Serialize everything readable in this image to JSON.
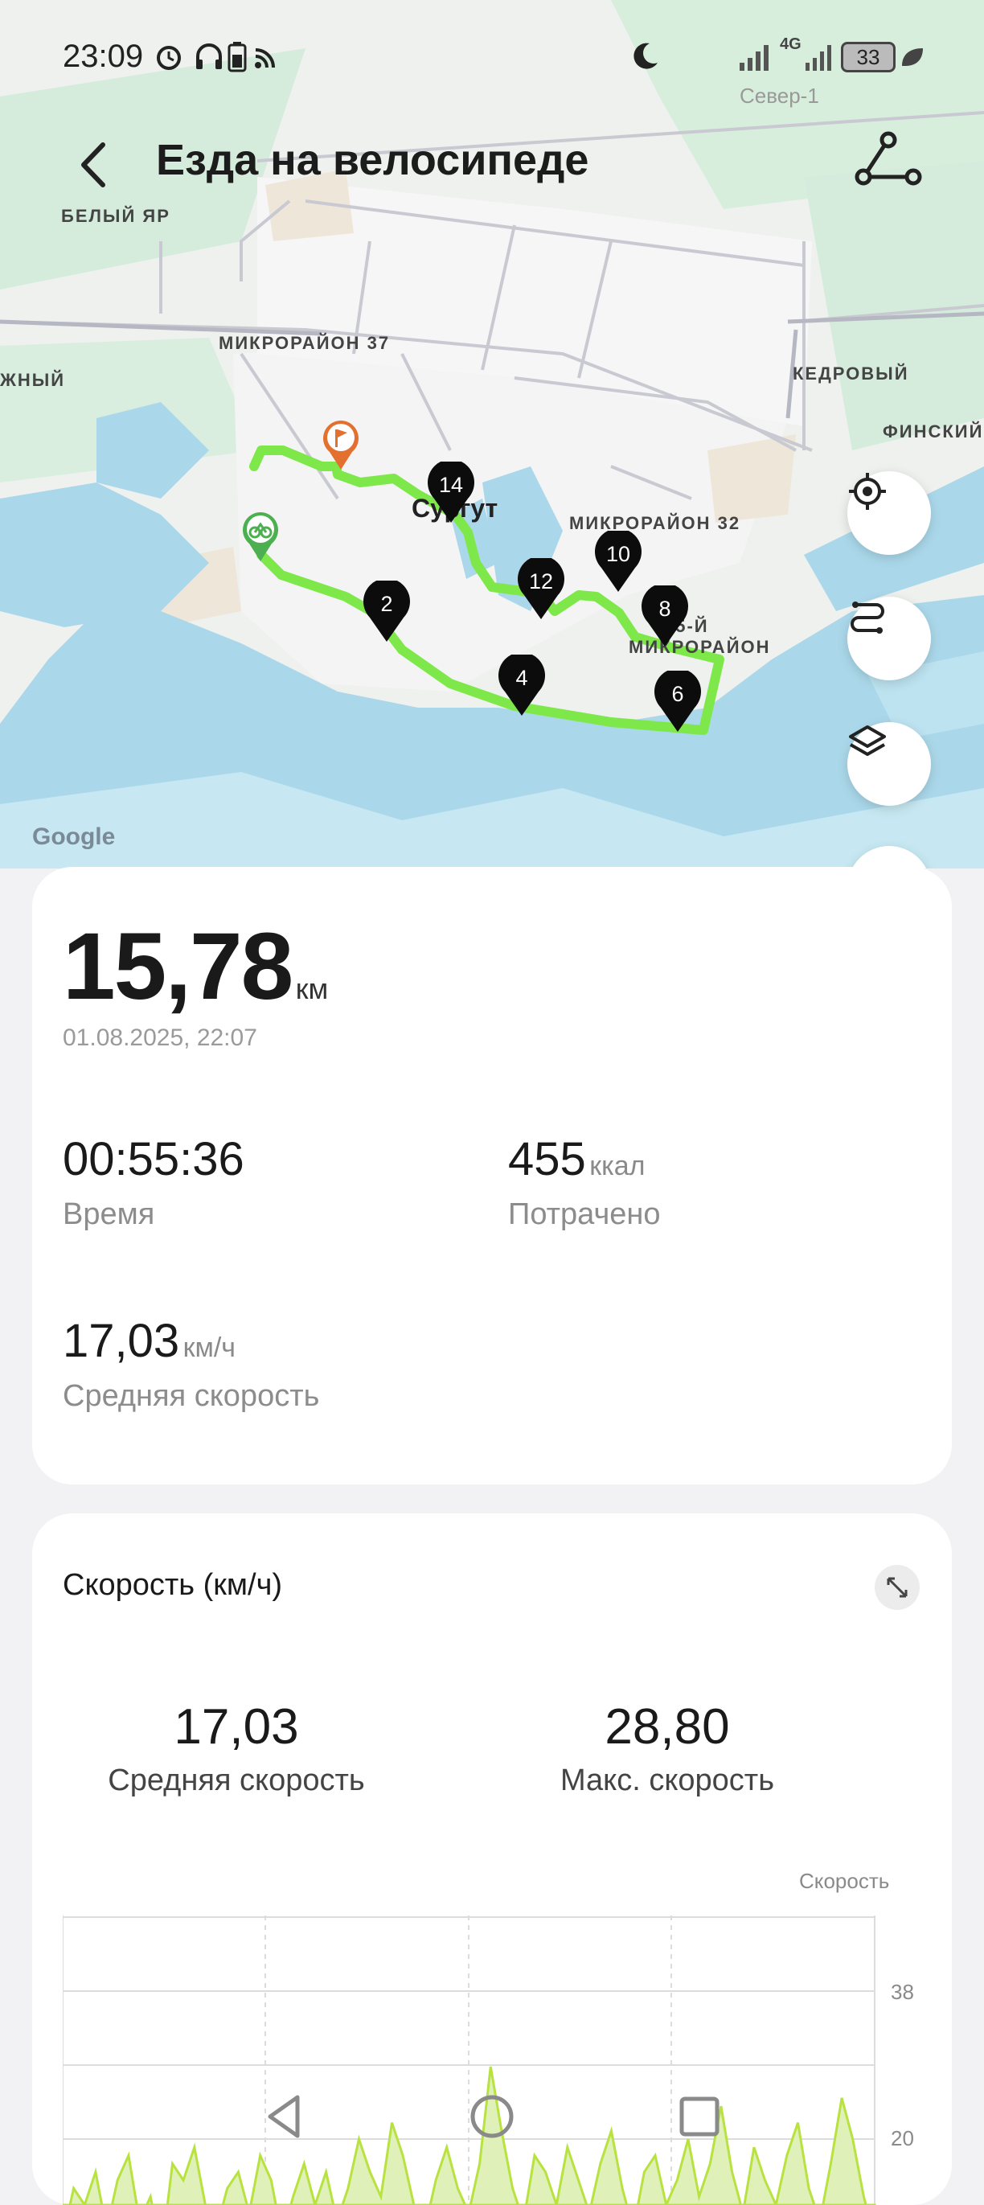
{
  "status_bar": {
    "time": "23:09",
    "battery": "33",
    "network": "4G",
    "carrier": "Север-1"
  },
  "header": {
    "title": "Езда на велосипеде"
  },
  "map": {
    "places": {
      "belyi_yar": "БЕЛЫЙ ЯР",
      "mkr37": "МИКРОРАЙОН 37",
      "kedrovyi": "КЕДРОВЫЙ",
      "finskii": "ФИНСКИЙ",
      "partial_left": "ЖНЫЙ",
      "surgut": "Сургут",
      "mkr32": "МИКРОРАЙОН 32",
      "mkr25_line1": "25-Й",
      "mkr25_line2": "МИКРОРАЙОН"
    },
    "markers": [
      "2",
      "4",
      "6",
      "8",
      "10",
      "12",
      "14"
    ],
    "logo": "Google",
    "route_color": "#7ee84a"
  },
  "summary": {
    "distance": "15,78",
    "distance_unit": "км",
    "datetime": "01.08.2025, 22:07",
    "duration": "00:55:36",
    "duration_label": "Время",
    "calories": "455",
    "calories_unit": "ккал",
    "calories_label": "Потрачено",
    "avg_speed": "17,03",
    "avg_speed_unit": "км/ч",
    "avg_speed_label": "Средняя скорость"
  },
  "speed_card": {
    "title": "Скорость (км/ч)",
    "avg_value": "17,03",
    "avg_label": "Средняя скорость",
    "max_value": "28,80",
    "max_label": "Макс. скорость",
    "legend": "Скорость"
  },
  "chart_data": {
    "type": "area",
    "title": "Скорость (км/ч)",
    "series": [
      {
        "name": "Скорость",
        "values": [
          8,
          14,
          12,
          16,
          9,
          15,
          18,
          10,
          13,
          6,
          17,
          15,
          19,
          12,
          9,
          14,
          16,
          11,
          18,
          15,
          8,
          13,
          17,
          12,
          16,
          10,
          14,
          20,
          16,
          13,
          22,
          18,
          12,
          9,
          15,
          19,
          14,
          11,
          17,
          28.8,
          21,
          14,
          10,
          18,
          16,
          12,
          19,
          15,
          11,
          17,
          21,
          14,
          9,
          16,
          18,
          12,
          15,
          20,
          13,
          17,
          24,
          16,
          11,
          19,
          15,
          12,
          18,
          22,
          14,
          10,
          17,
          25,
          20,
          13,
          8
        ]
      }
    ],
    "yticks": [
      "38",
      "20"
    ],
    "color": "#b8e23f"
  },
  "nav_bar": {
    "back": "back-nav",
    "home": "home-nav",
    "recents": "recents-nav"
  }
}
